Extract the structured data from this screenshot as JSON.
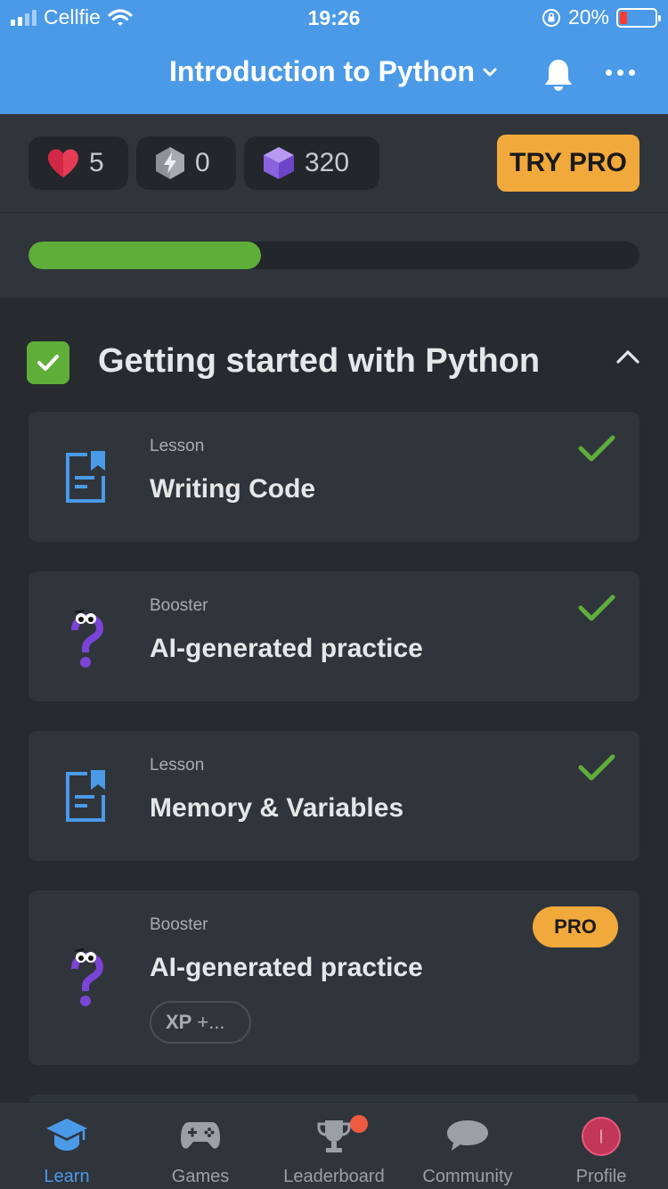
{
  "status_bar": {
    "carrier": "Cellfie",
    "time": "19:26",
    "battery_percent": "20%"
  },
  "nav": {
    "title": "Introduction to Python"
  },
  "stats": {
    "hearts": "5",
    "streak": "0",
    "gems": "320",
    "try_pro_label": "TRY PRO"
  },
  "progress": {
    "fraction": 0.38
  },
  "section": {
    "title": "Getting started with Python"
  },
  "cards": [
    {
      "type": "Lesson",
      "title": "Writing Code",
      "completed": true,
      "icon": "lesson-icon"
    },
    {
      "type": "Booster",
      "title": "AI-generated practice",
      "completed": true,
      "icon": "booster-icon"
    },
    {
      "type": "Lesson",
      "title": "Memory & Variables",
      "completed": true,
      "icon": "lesson-icon"
    },
    {
      "type": "Booster",
      "title": "AI-generated practice",
      "completed": false,
      "icon": "booster-icon",
      "badge": "PRO",
      "xp_label": "XP",
      "xp_value": "+..."
    }
  ],
  "tabs": [
    {
      "label": "Learn",
      "icon": "graduation-cap-icon",
      "active": true
    },
    {
      "label": "Games",
      "icon": "gamepad-icon",
      "active": false
    },
    {
      "label": "Leaderboard",
      "icon": "trophy-icon",
      "active": false
    },
    {
      "label": "Community",
      "icon": "chat-bubble-icon",
      "active": false
    },
    {
      "label": "Profile",
      "icon": "avatar-icon",
      "active": false
    }
  ],
  "colors": {
    "accent": "#4a9ae8",
    "success": "#5fae3a",
    "pro": "#f2a93b",
    "background": "#272b30",
    "card": "#30353c"
  }
}
